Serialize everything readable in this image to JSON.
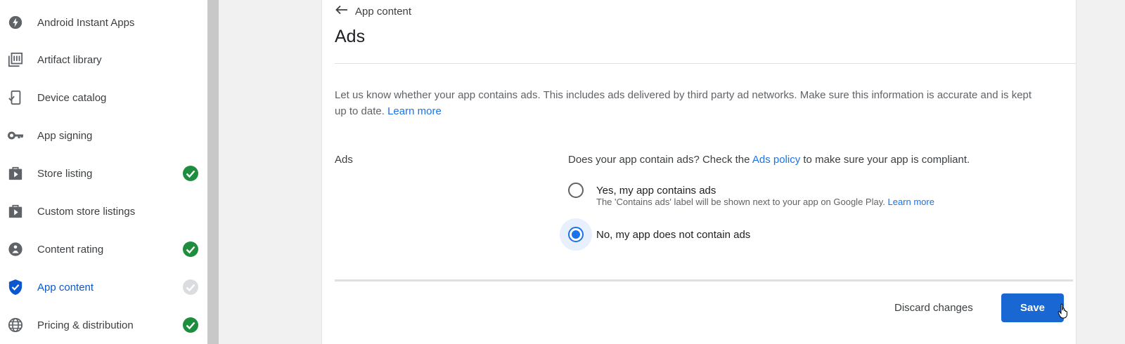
{
  "sidebar": {
    "items": [
      {
        "label": "Android Instant Apps",
        "icon": "instant-apps-icon",
        "status": "none",
        "active": false
      },
      {
        "label": "Artifact library",
        "icon": "library-icon",
        "status": "none",
        "active": false
      },
      {
        "label": "Device catalog",
        "icon": "device-catalog-icon",
        "status": "none",
        "active": false
      },
      {
        "label": "App signing",
        "icon": "key-icon",
        "status": "none",
        "active": false
      },
      {
        "label": "Store listing",
        "icon": "store-icon",
        "status": "complete",
        "active": false
      },
      {
        "label": "Custom store listings",
        "icon": "store-icon",
        "status": "none",
        "active": false
      },
      {
        "label": "Content rating",
        "icon": "content-rating-icon",
        "status": "complete",
        "active": false
      },
      {
        "label": "App content",
        "icon": "shield-icon",
        "status": "pending",
        "active": true
      },
      {
        "label": "Pricing & distribution",
        "icon": "globe-icon",
        "status": "complete",
        "active": false
      }
    ]
  },
  "header": {
    "back_label": "App content",
    "title": "Ads"
  },
  "intro": {
    "text": "Let us know whether your app contains ads. This includes ads delivered by third party ad networks. Make sure this information is accurate and is kept up to date.",
    "link": "Learn more"
  },
  "form": {
    "section_label": "Ads",
    "question_prefix": "Does your app contain ads? Check the",
    "question_link": "Ads policy",
    "question_suffix": "to make sure your app is compliant.",
    "options": [
      {
        "label": "Yes, my app contains ads",
        "selected": false
      },
      {
        "label": "No, my app does not contain ads",
        "selected": true
      }
    ],
    "yes_help": "The 'Contains ads' label will be shown next to your app on Google Play.",
    "yes_help_link": "Learn more"
  },
  "actions": {
    "discard_label": "Discard changes",
    "save_label": "Save"
  },
  "colors": {
    "accent": "#1a73e8",
    "success": "#1e8e3e",
    "pending": "#dadce0"
  }
}
